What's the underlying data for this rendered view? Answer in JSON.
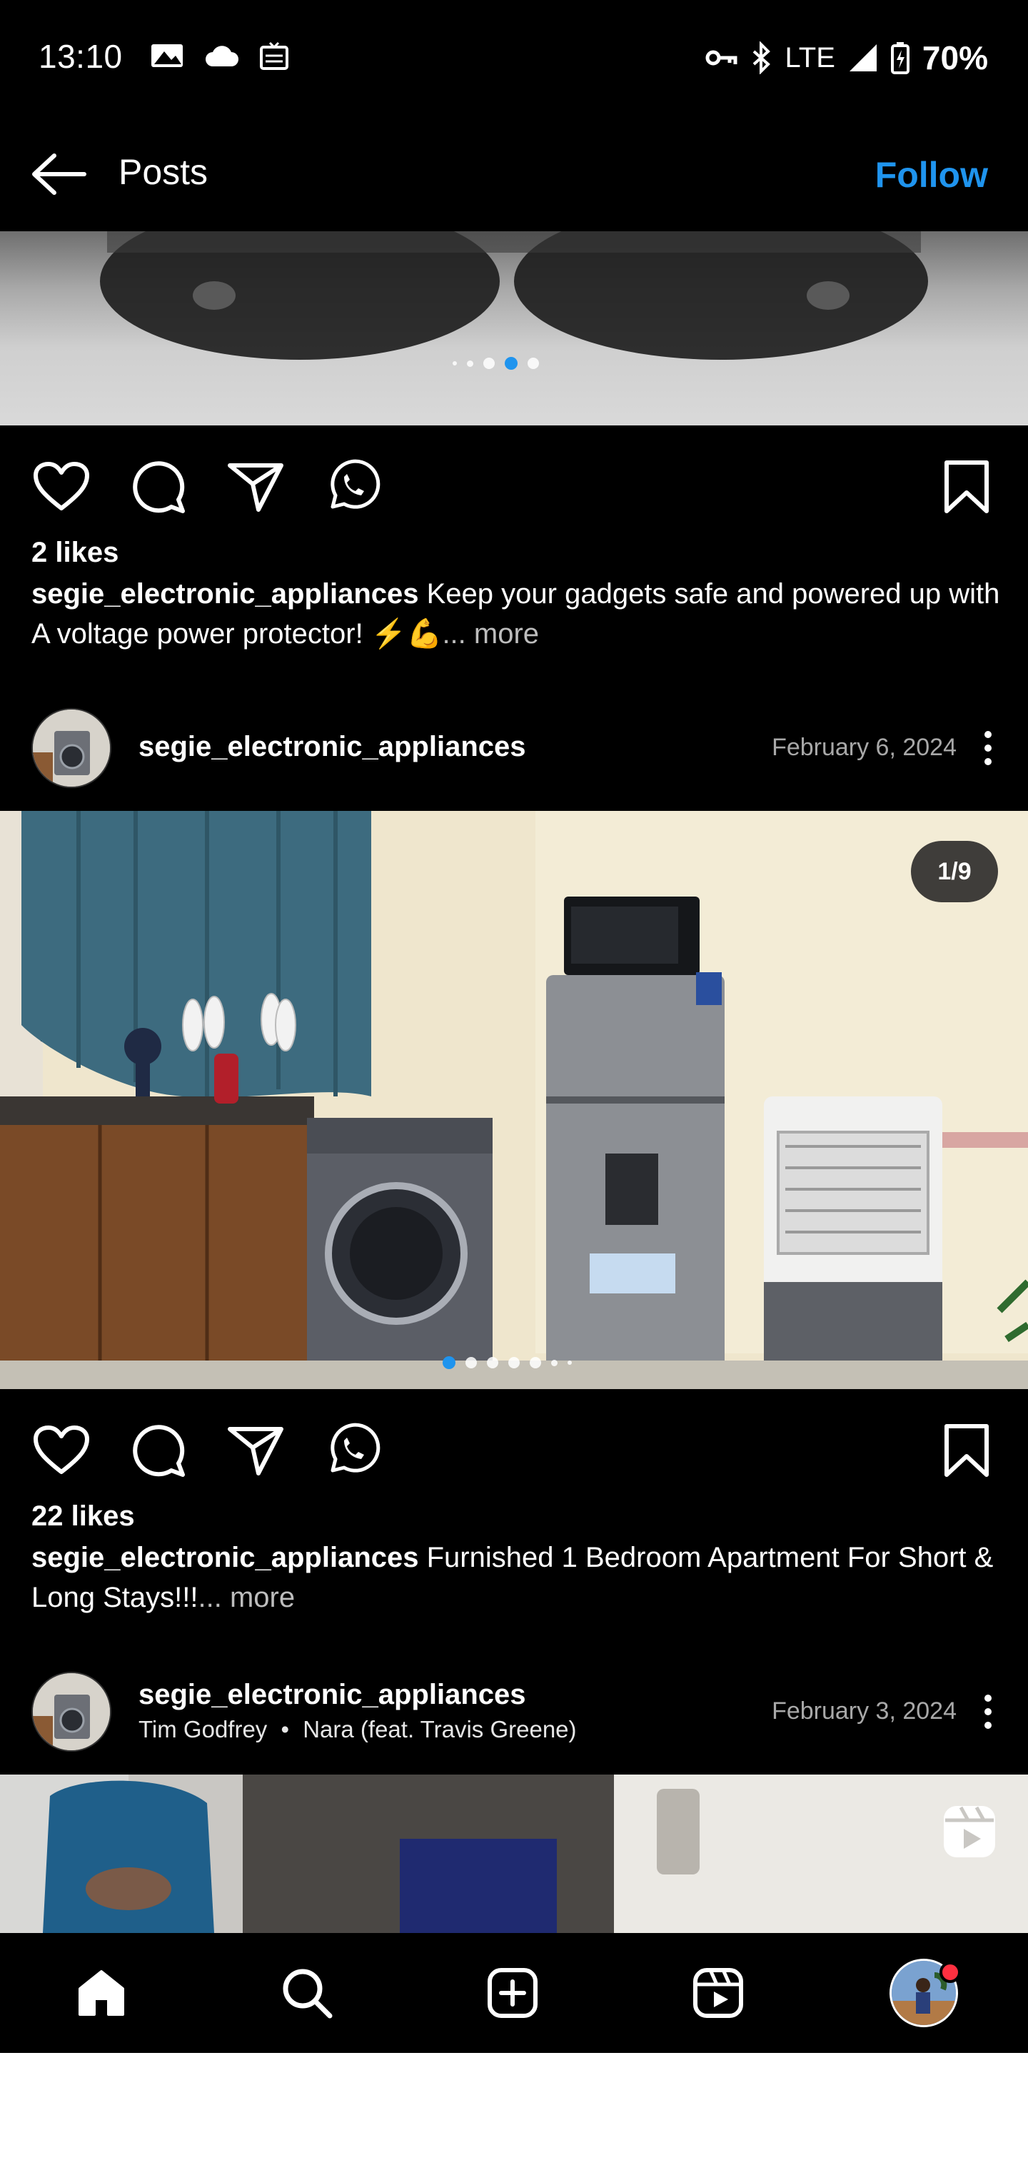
{
  "status_bar": {
    "time": "13:10",
    "network": "LTE",
    "battery": "70%",
    "left_icons": [
      "gallery-icon",
      "cloud-icon",
      "sim-icon"
    ],
    "right_icons": [
      "vpn-key-icon",
      "bluetooth-icon",
      "signal-icon",
      "battery-icon"
    ]
  },
  "top_bar": {
    "title": "Posts",
    "follow_label": "Follow"
  },
  "colors": {
    "accent": "#1f94ee",
    "background": "#000000",
    "notification": "#ff3040"
  },
  "posts": [
    {
      "carousel": {
        "count": 5,
        "active_index": 3
      },
      "likes": "2 likes",
      "username": "segie_electronic_appliances",
      "caption": "Keep your gadgets safe and powered up with A voltage power protector! ⚡💪",
      "more_label": "... more"
    },
    {
      "username": "segie_electronic_appliances",
      "date": "February 6, 2024",
      "media_counter": "1/9",
      "carousel": {
        "count": 7,
        "active_index": 0
      },
      "likes": "22 likes",
      "caption": "Furnished 1 Bedroom Apartment For Short & Long Stays!!!",
      "more_label": "... more"
    },
    {
      "username": "segie_electronic_appliances",
      "audio_artist": "Tim Godfrey",
      "audio_separator": "•",
      "audio_track": "Nara (feat. Travis Greene)",
      "date": "February 3, 2024",
      "media_type_icon": "reels-icon"
    }
  ],
  "bottom_nav": [
    "home-icon",
    "search-icon",
    "create-icon",
    "reels-icon",
    "profile-avatar"
  ]
}
